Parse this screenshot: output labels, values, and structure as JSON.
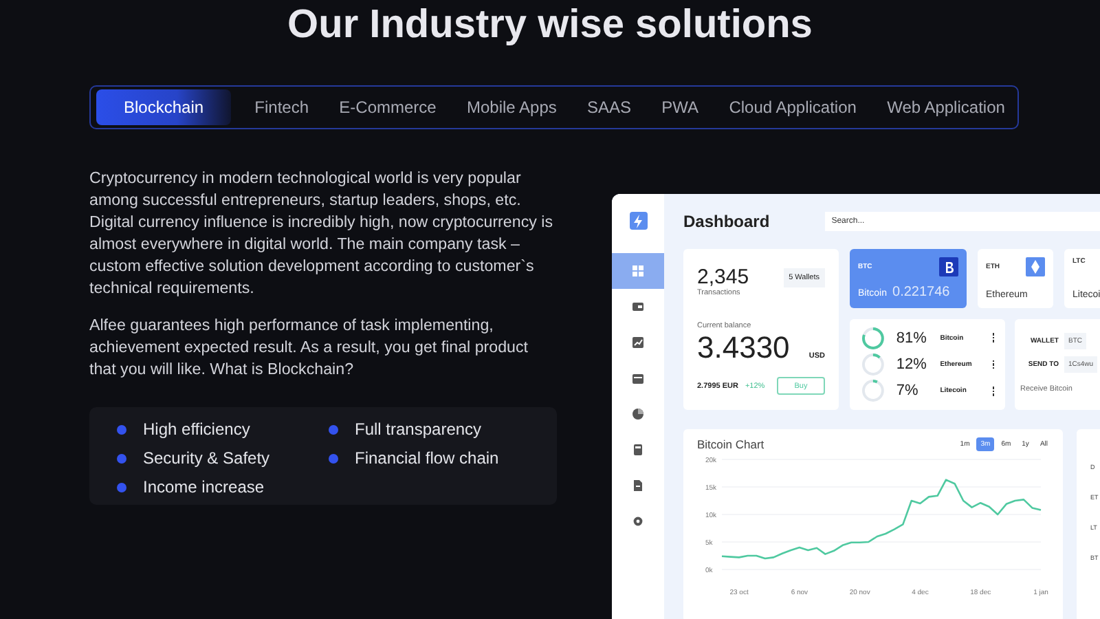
{
  "heading": "Our Industry wise solutions",
  "tabs": [
    {
      "label": "Blockchain",
      "selected": true
    },
    {
      "label": "Fintech",
      "selected": false
    },
    {
      "label": "E-Commerce",
      "selected": false
    },
    {
      "label": "Mobile Apps",
      "selected": false
    },
    {
      "label": "SAAS",
      "selected": false
    },
    {
      "label": "PWA",
      "selected": false
    },
    {
      "label": "Cloud Application",
      "selected": false
    },
    {
      "label": "Web Application",
      "selected": false
    }
  ],
  "paragraphs": [
    "Cryptocurrency in modern technological world is very popular among successful entrepreneurs, startup leaders, shops, etc. Digital currency influence is incredibly high, now cryptocurrency is almost everywhere in digital world. The main company task – custom effective solution development according to customer`s technical requirements.",
    "Alfee guarantees high performance of task implementing, achievement expected result. As a result, you get final product that you will like. What is Blockchain?"
  ],
  "features": [
    "High efficiency",
    "Full transparency",
    "Security & Safety",
    "Financial flow chain",
    "Income increase"
  ],
  "dashboard": {
    "title": "Dashboard",
    "search": {
      "placeholder": "Search..."
    },
    "sidebar": [
      {
        "selected": true
      },
      {
        "selected": false
      },
      {
        "selected": false
      },
      {
        "selected": false
      },
      {
        "selected": false
      },
      {
        "selected": false
      },
      {
        "selected": false
      },
      {
        "selected": false
      }
    ],
    "stats": {
      "count": "2,345",
      "count_label": "Transactions",
      "wallets": "5  Wallets",
      "balance_label": "Current balance",
      "balance": "3.4330",
      "currency": "USD",
      "eur": "2.7995  EUR",
      "change": "+12%",
      "buy": "Buy"
    },
    "coins": [
      {
        "symbol": "BTC",
        "name": "Bitcoin",
        "amount": "0.221746",
        "selected": true
      },
      {
        "symbol": "ETH",
        "name": "Ethereum",
        "selected": false
      },
      {
        "symbol": "LTC",
        "name": "Litecoi",
        "selected": false
      }
    ],
    "shares": [
      {
        "percent": "81%",
        "name": "Bitcoin",
        "level": 0.81
      },
      {
        "percent": "12%",
        "name": "Ethereum",
        "level": 0.12
      },
      {
        "percent": "7%",
        "name": "Litecoin",
        "level": 0.07
      }
    ],
    "wallet": {
      "wallet_label": "WALLET",
      "wallet_value": "BTC",
      "send_label": "SEND TO",
      "send_value": "1Cs4wu",
      "link": "Receive Bitcoin"
    },
    "chart": {
      "title": "Bitcoin Chart",
      "ranges": [
        {
          "label": "1m",
          "selected": false
        },
        {
          "label": "3m",
          "selected": true
        },
        {
          "label": "6m",
          "selected": false
        },
        {
          "label": "1y",
          "selected": false
        },
        {
          "label": "All",
          "selected": false
        }
      ],
      "chart_data": {
        "type": "line",
        "categories": [
          null,
          null,
          "23 oct",
          null,
          null,
          null,
          null,
          null,
          null,
          "6 nov",
          null,
          null,
          null,
          null,
          null,
          null,
          "20 nov",
          null,
          null,
          null,
          null,
          null,
          null,
          "4 dec",
          null,
          null,
          null,
          null,
          null,
          null,
          "18 dec",
          null,
          null,
          null,
          null,
          null,
          null,
          "1 jan"
        ],
        "grid": true,
        "series": [
          {
            "color": "#4fc9a0",
            "values": [
              2.4,
              2.3,
              2.2,
              2.5,
              2.5,
              2.0,
              2.2,
              2.9,
              3.5,
              4.0,
              3.5,
              3.9,
              2.8,
              3.4,
              4.4,
              4.9,
              4.9,
              5.0,
              6.0,
              6.5,
              7.3,
              8.2,
              12.5,
              12,
              13.2,
              13.4,
              16.3,
              15.6,
              12.5,
              11.3,
              12.1,
              11.4,
              10.0,
              11.9,
              12.5,
              12.7,
              11.2,
              10.8
            ]
          }
        ],
        "ylim": [
          0,
          20
        ],
        "yticks": [
          {
            "value": 0,
            "label": "0k"
          },
          {
            "value": 5,
            "label": "5k"
          },
          {
            "value": 10,
            "label": "10k"
          },
          {
            "value": 15,
            "label": "15k"
          },
          {
            "value": 20,
            "label": "20k"
          }
        ]
      }
    },
    "side_labels": [
      "D",
      "ET",
      "LT",
      "BT"
    ]
  }
}
